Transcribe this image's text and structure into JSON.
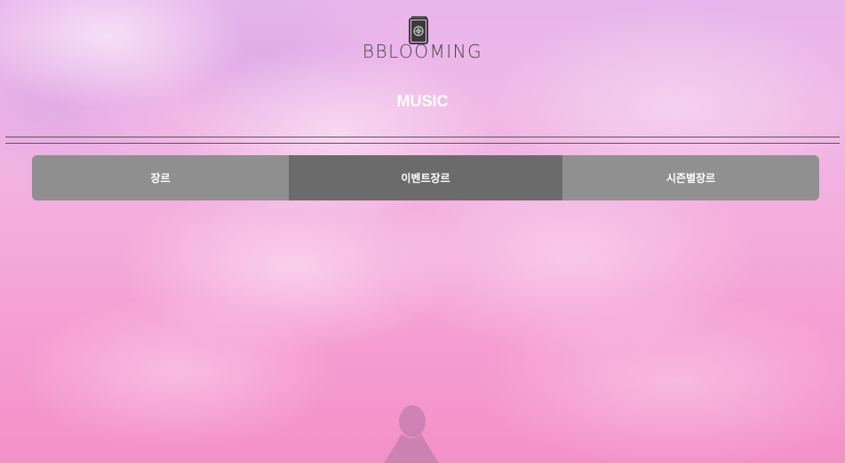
{
  "header": {
    "logo_text": "BBLOOMING",
    "logo_icon": "book-icon"
  },
  "page": {
    "title": "MUSIC"
  },
  "tabs": [
    {
      "label": "장르"
    },
    {
      "label": "이벤트장르"
    },
    {
      "label": "시즌별장르"
    }
  ],
  "colors": {
    "tab_bg": "#8f8f8f",
    "tab_active_bg": "#6b6b6b",
    "tab_text": "#ffffff",
    "divider": "#555555",
    "background_top": "#e8b6ec",
    "background_bottom": "#f391c9"
  }
}
